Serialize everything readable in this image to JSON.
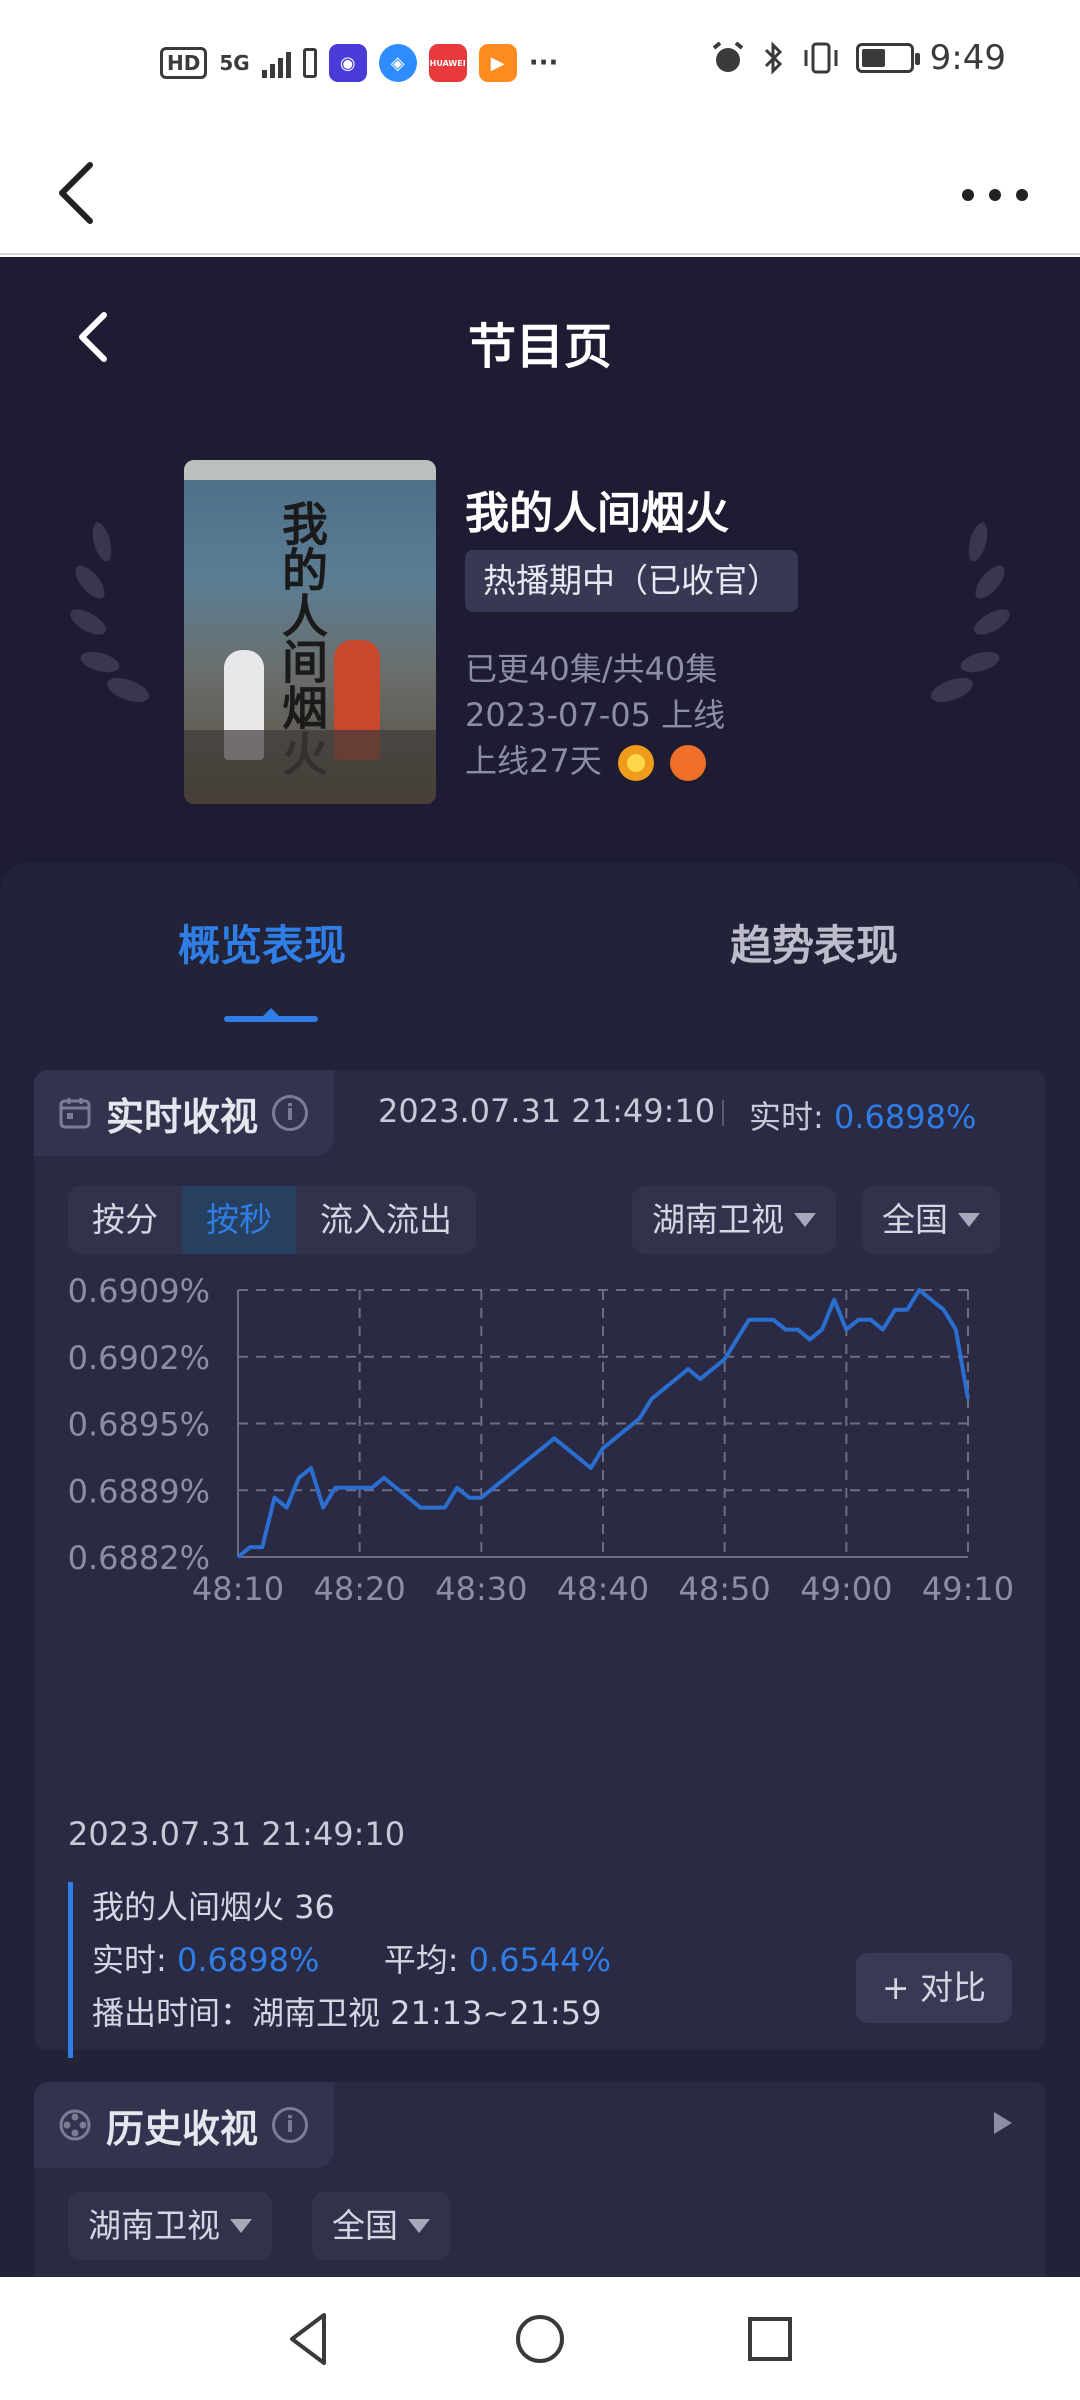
{
  "status_bar": {
    "network_badge": "HD",
    "network_type": "5G",
    "app_icons": [
      {
        "name": "notification-app-icon",
        "color": "#4b3bd6"
      },
      {
        "name": "browser-app-icon",
        "color": "#2f8cff"
      },
      {
        "name": "huawei-app-icon",
        "color": "#e83a3a",
        "text": "HUAWEI"
      },
      {
        "name": "video-app-icon",
        "color": "#ff8a1f"
      }
    ],
    "more_dots": "···",
    "time": "9:49"
  },
  "app": {
    "page_title": "节目页",
    "show": {
      "title": "我的人间烟火",
      "status": "热播期中（已收官）",
      "episodes": "已更40集/共40集",
      "premiere": "2023-07-05 上线",
      "days_online": "上线27天",
      "poster_text": "我的人间烟火"
    },
    "tabs": [
      {
        "label": "概览表现",
        "active": true
      },
      {
        "label": "趋势表现",
        "active": false
      }
    ],
    "realtime": {
      "section_title": "实时收视",
      "info_glyph": "i",
      "timestamp": "2023.07.31 21:49:10",
      "realtime_label": "实时:",
      "realtime_value": "0.6898%",
      "segments": [
        "按分",
        "按秒",
        "流入流出"
      ],
      "active_segment": "按秒",
      "channel": "湖南卫视",
      "region": "全国"
    },
    "chart_data": {
      "type": "line",
      "x": [
        "48:10",
        "48:20",
        "48:30",
        "48:40",
        "48:50",
        "49:00",
        "49:10"
      ],
      "yticks": [
        "0.6909%",
        "0.6902%",
        "0.6895%",
        "0.6889%",
        "0.6882%"
      ],
      "ylim": [
        0.6882,
        0.6909
      ],
      "grid": true,
      "color": "#2a6fd0",
      "series": [
        {
          "points": [
            [
              0,
              0.6882
            ],
            [
              1,
              0.6883
            ],
            [
              2,
              0.6883
            ],
            [
              3,
              0.6888
            ],
            [
              4,
              0.6887
            ],
            [
              5,
              0.689
            ],
            [
              6,
              0.6891
            ],
            [
              7,
              0.6887
            ],
            [
              8,
              0.6889
            ],
            [
              9,
              0.6889
            ],
            [
              10,
              0.6889
            ],
            [
              11,
              0.6889
            ],
            [
              12,
              0.689
            ],
            [
              13,
              0.6889
            ],
            [
              14,
              0.6888
            ],
            [
              15,
              0.6887
            ],
            [
              16,
              0.6887
            ],
            [
              17,
              0.6887
            ],
            [
              18,
              0.6889
            ],
            [
              19,
              0.6888
            ],
            [
              20,
              0.6888
            ],
            [
              21,
              0.6889
            ],
            [
              22,
              0.689
            ],
            [
              23,
              0.6891
            ],
            [
              24,
              0.6892
            ],
            [
              25,
              0.6893
            ],
            [
              26,
              0.6894
            ],
            [
              27,
              0.6893
            ],
            [
              28,
              0.6892
            ],
            [
              29,
              0.6891
            ],
            [
              30,
              0.6893
            ],
            [
              31,
              0.6894
            ],
            [
              32,
              0.6895
            ],
            [
              33,
              0.6896
            ],
            [
              34,
              0.6898
            ],
            [
              35,
              0.6899
            ],
            [
              36,
              0.69
            ],
            [
              37,
              0.6901
            ],
            [
              38,
              0.69
            ],
            [
              39,
              0.6901
            ],
            [
              40,
              0.6902
            ],
            [
              41,
              0.6904
            ],
            [
              42,
              0.6906
            ],
            [
              43,
              0.6906
            ],
            [
              44,
              0.6906
            ],
            [
              45,
              0.6905
            ],
            [
              46,
              0.6905
            ],
            [
              47,
              0.6904
            ],
            [
              48,
              0.6905
            ],
            [
              49,
              0.6908
            ],
            [
              50,
              0.6905
            ],
            [
              51,
              0.6906
            ],
            [
              52,
              0.6906
            ],
            [
              53,
              0.6905
            ],
            [
              54,
              0.6907
            ],
            [
              55,
              0.6907
            ],
            [
              56,
              0.6909
            ],
            [
              57,
              0.6908
            ],
            [
              58,
              0.6907
            ],
            [
              59,
              0.6905
            ],
            [
              60,
              0.6898
            ]
          ]
        }
      ]
    },
    "detail": {
      "timestamp": "2023.07.31 21:49:10",
      "episode": "我的人间烟火 36",
      "realtime_label": "实时:",
      "realtime_value": "0.6898%",
      "avg_label": "平均:",
      "avg_value": "0.6544%",
      "airtime": "播出时间：湖南卫视 21:13~21:59",
      "compare_button": "+ 对比"
    },
    "history": {
      "section_title": "历史收视",
      "info_glyph": "i",
      "channel": "湖南卫视",
      "region": "全国"
    }
  }
}
